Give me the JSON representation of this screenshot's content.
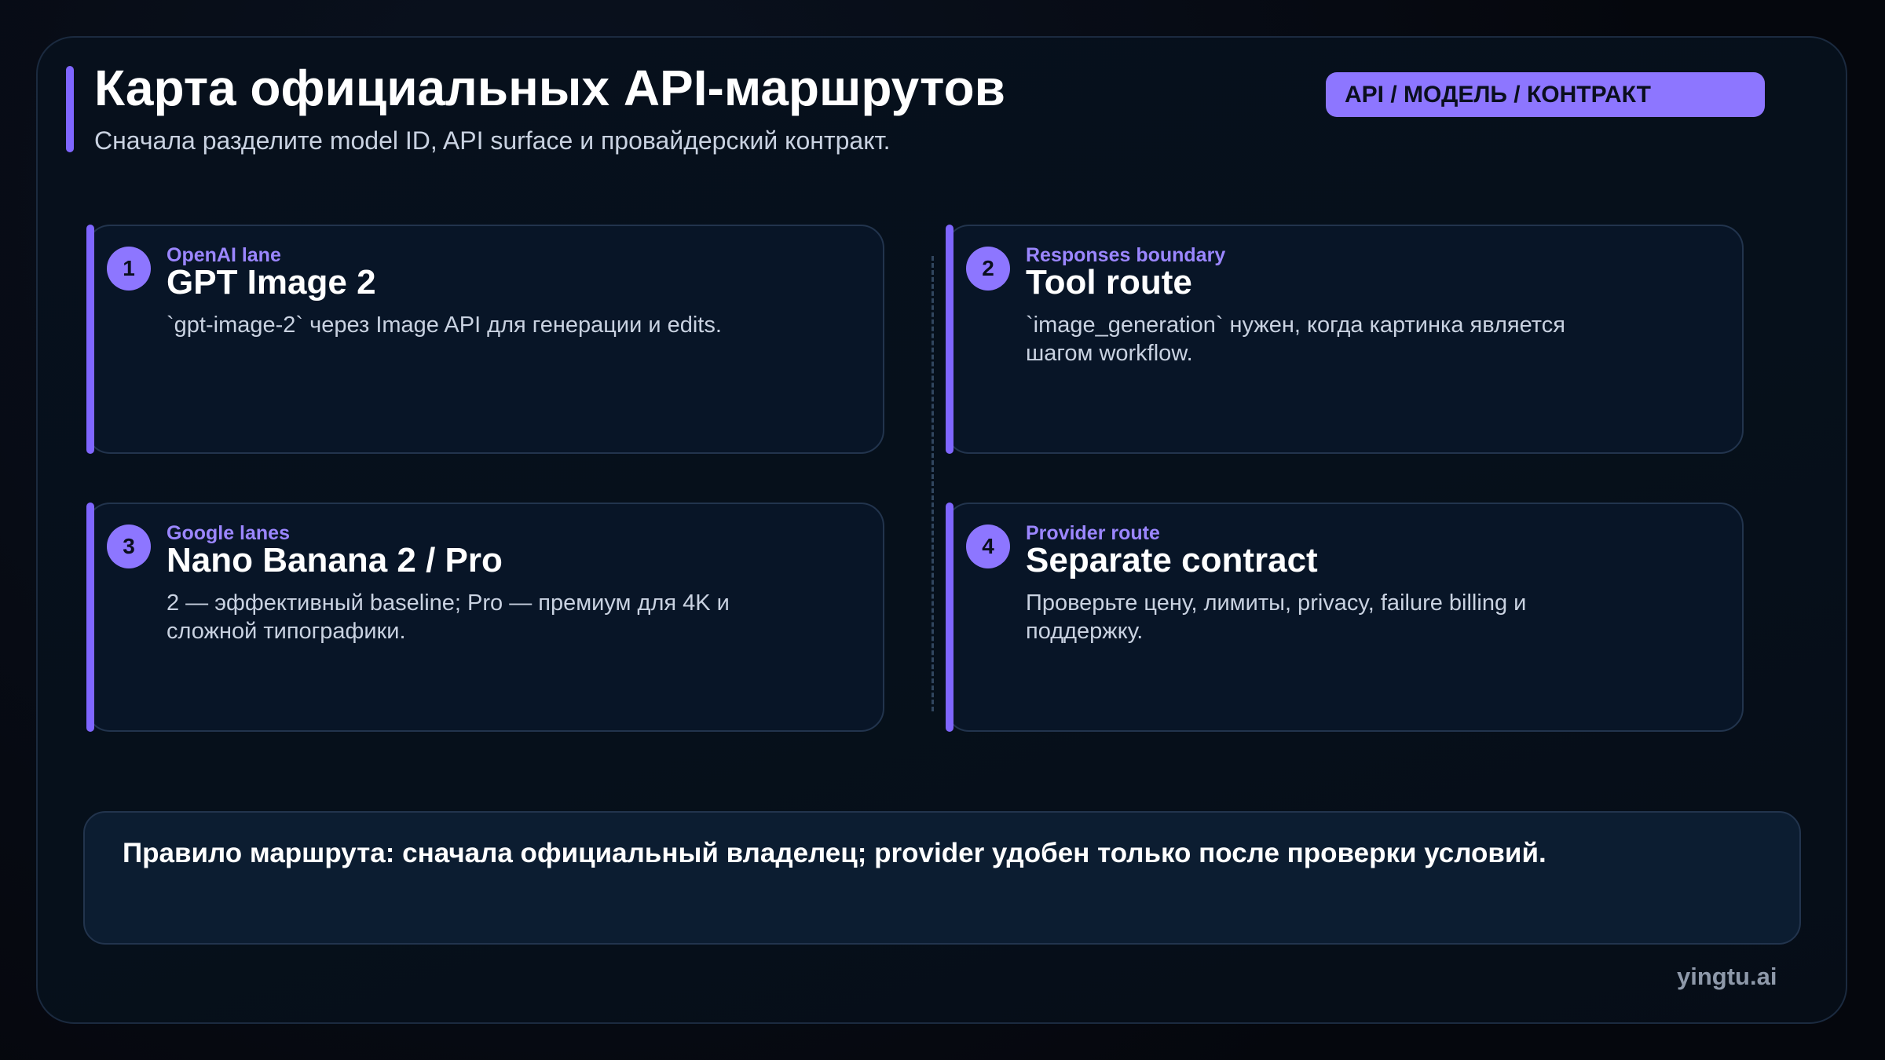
{
  "header": {
    "title": "Карта официальных API-маршрутов",
    "subtitle": "Сначала разделите model ID, API surface и провайдерский контракт.",
    "badge": "API / МОДЕЛЬ / КОНТРАКТ"
  },
  "cards": [
    {
      "number": "1",
      "eyebrow": "OpenAI lane",
      "title": "GPT Image 2",
      "description": "`gpt-image-2` через Image API для генерации и edits."
    },
    {
      "number": "2",
      "eyebrow": "Responses boundary",
      "title": "Tool route",
      "description": "`image_generation` нужен, когда картинка является шагом workflow."
    },
    {
      "number": "3",
      "eyebrow": "Google lanes",
      "title": "Nano Banana 2 / Pro",
      "description": "2 — эффективный baseline; Pro — премиум для 4K и сложной типографики."
    },
    {
      "number": "4",
      "eyebrow": "Provider route",
      "title": "Separate contract",
      "description": "Проверьте цену, лимиты, privacy, failure billing и поддержку."
    }
  ],
  "rule": {
    "text": "Правило маршрута: сначала официальный владелец; provider удобен только после проверки условий."
  },
  "footer": {
    "brand": "yingtu.ai"
  },
  "colors": {
    "accent": "#8d76ff",
    "background": "#05070d",
    "card": "#081527"
  }
}
